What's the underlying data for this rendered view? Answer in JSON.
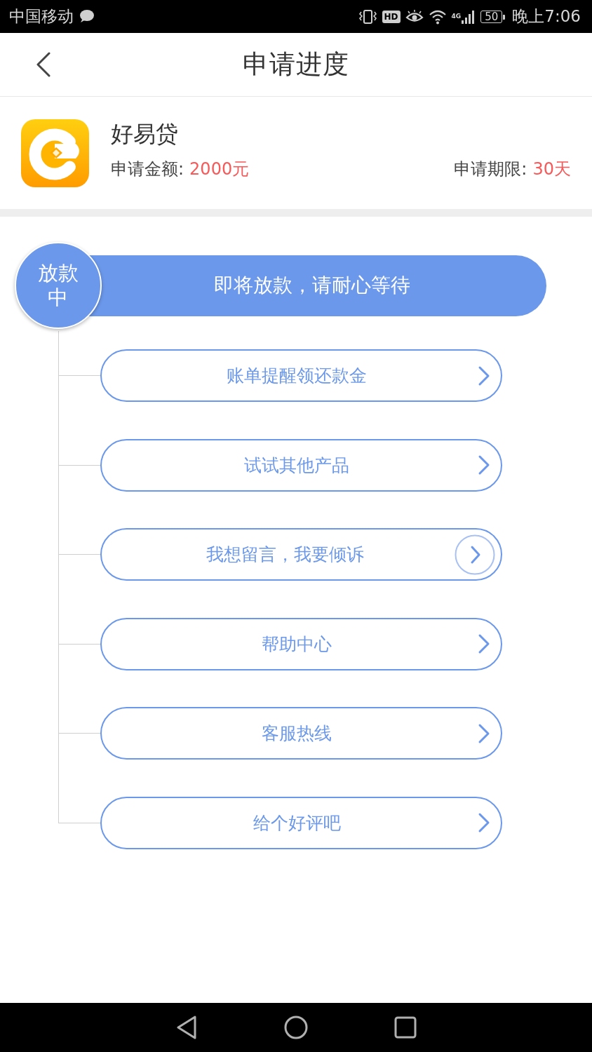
{
  "status_bar": {
    "carrier": "中国移动",
    "hd_badge": "HD",
    "network": "4G",
    "battery": "50",
    "time": "晚上7:06"
  },
  "header": {
    "title": "申请进度"
  },
  "product": {
    "name": "好易贷",
    "amount_label": "申请金额:",
    "amount": "2000元",
    "term_label": "申请期限:",
    "term": "30天"
  },
  "progress": {
    "status": "放款中",
    "message": "即将放款，请耐心等待"
  },
  "actions": [
    {
      "label": "账单提醒领还款金",
      "focused": false
    },
    {
      "label": "试试其他产品",
      "focused": false
    },
    {
      "label": "我想留言，我要倾诉",
      "focused": true
    },
    {
      "label": "帮助中心",
      "focused": false
    },
    {
      "label": "客服热线",
      "focused": false
    },
    {
      "label": "给个好评吧",
      "focused": false
    }
  ]
}
